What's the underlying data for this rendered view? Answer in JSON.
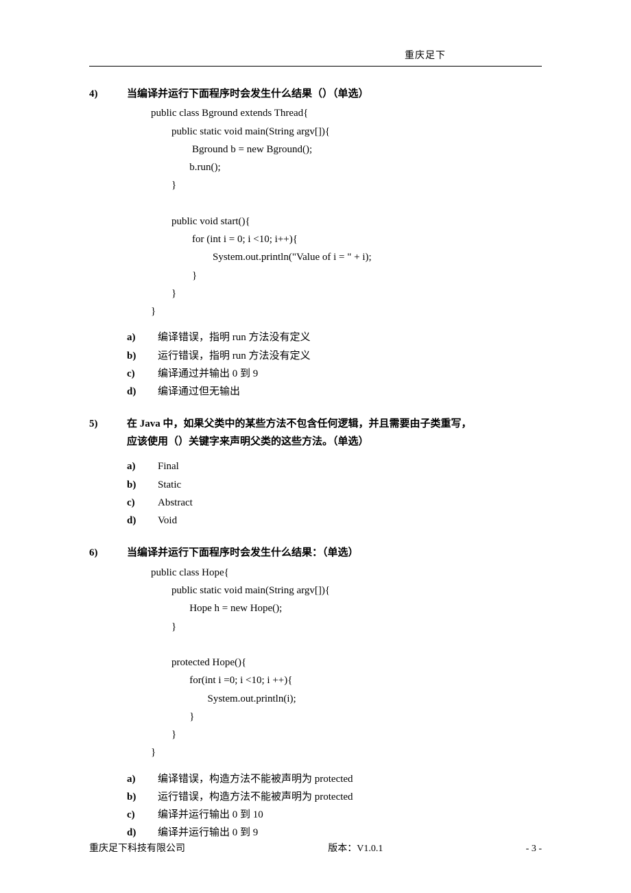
{
  "header": "重庆足下",
  "questions": [
    {
      "num": "4)",
      "text": "当编译并运行下面程序时会发生什么结果（）（单选）",
      "code": "public class Bground extends Thread{\n        public static void main(String argv[]){\n                Bground b = new Bground();\n               b.run();\n        }\n\n        public void start(){\n                for (int i = 0; i <10; i++){\n                        System.out.println(\"Value of i = \" + i);\n                }\n        }\n}",
      "options": [
        {
          "label": "a)",
          "text": "编译错误，指明 run 方法没有定义"
        },
        {
          "label": "b)",
          "text": "运行错误，指明 run 方法没有定义"
        },
        {
          "label": "c)",
          "text": "编译通过并输出 0 到 9"
        },
        {
          "label": "d)",
          "text": "编译通过但无输出"
        }
      ]
    },
    {
      "num": "5)",
      "text": "在 Java 中，如果父类中的某些方法不包含任何逻辑，并且需要由子类重写，",
      "text2": "应该使用（）关键字来声明父类的这些方法。（单选）",
      "options": [
        {
          "label": "a)",
          "text": "Final"
        },
        {
          "label": "b)",
          "text": "Static"
        },
        {
          "label": "c)",
          "text": "Abstract"
        },
        {
          "label": "d)",
          "text": "Void"
        }
      ]
    },
    {
      "num": "6)",
      "text": "当编译并运行下面程序时会发生什么结果：（单选）",
      "code": "public class Hope{\n        public static void main(String argv[]){\n               Hope h = new Hope();\n        }\n\n        protected Hope(){\n               for(int i =0; i <10; i ++){\n                      System.out.println(i);\n               }\n        }\n}",
      "options": [
        {
          "label": "a)",
          "text": "编译错误，构造方法不能被声明为 protected"
        },
        {
          "label": "b)",
          "text": "运行错误，构造方法不能被声明为 protected"
        },
        {
          "label": "c)",
          "text": "编译并运行输出 0 到 10"
        },
        {
          "label": "d)",
          "text": "编译并运行输出 0 到 9"
        }
      ]
    }
  ],
  "footer": {
    "left": "重庆足下科技有限公司",
    "center": "版本：V1.0.1",
    "right": "- 3 -"
  }
}
